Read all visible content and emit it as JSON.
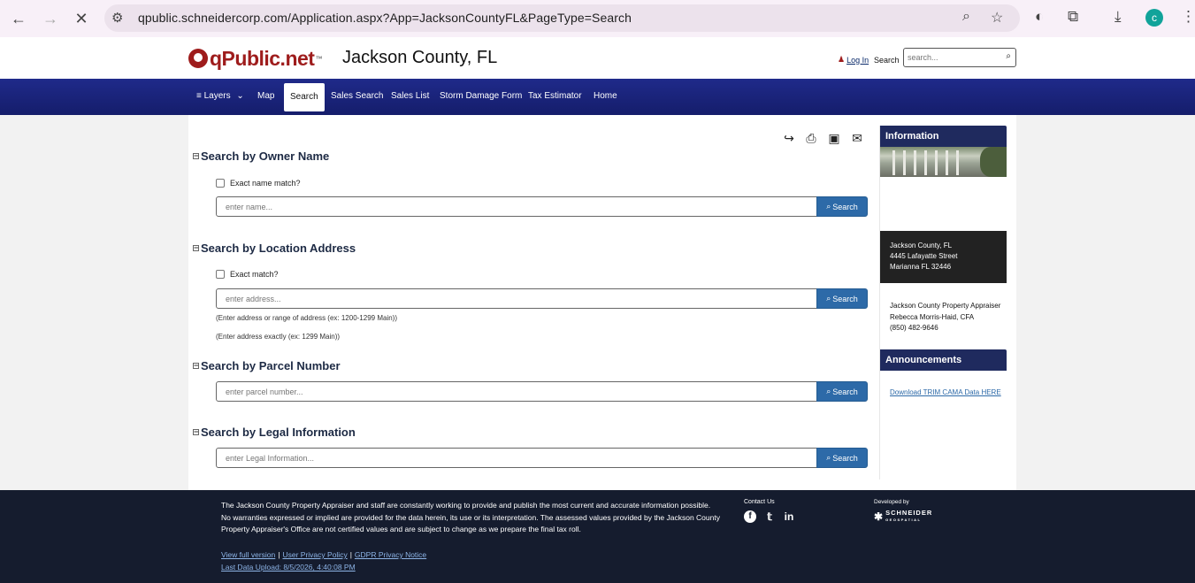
{
  "browser": {
    "url": "qpublic.schneidercorp.com/Application.aspx?App=JacksonCountyFL&PageType=Search",
    "avatar_letter": "c"
  },
  "header": {
    "logo_text": "qPublic.net",
    "logo_tm": "™",
    "county_title": "Jackson County, FL",
    "login_label": "Log In",
    "search_label": "Search",
    "search_placeholder": "search..."
  },
  "navbar": {
    "items": [
      {
        "label": "Layers"
      },
      {
        "label": "Map"
      },
      {
        "label": "Search"
      },
      {
        "label": "Sales Search"
      },
      {
        "label": "Sales List"
      },
      {
        "label": "Storm Damage Form"
      },
      {
        "label": "Tax Estimator"
      },
      {
        "label": "Home"
      }
    ],
    "active": "Search"
  },
  "sections": {
    "owner": {
      "title": "Search by Owner Name",
      "checkbox_label": "Exact name match?",
      "placeholder": "enter name...",
      "button": "Search"
    },
    "location": {
      "title": "Search by Location Address",
      "checkbox_label": "Exact match?",
      "placeholder": "enter address...",
      "button": "Search",
      "hint1": "(Enter address or range of address (ex: 1200-1299 Main))",
      "hint2": "(Enter address exactly (ex: 1299 Main))"
    },
    "parcel": {
      "title": "Search by Parcel Number",
      "placeholder": "enter parcel number...",
      "button": "Search"
    },
    "legal": {
      "title": "Search by Legal Information",
      "placeholder": "enter Legal Information...",
      "button": "Search"
    }
  },
  "sidebar": {
    "information_title": "Information",
    "address_lines": [
      "Jackson County, FL",
      "4445 Lafayatte Street",
      "Marianna FL 32446"
    ],
    "appraiser_lines": [
      "Jackson County Property Appraiser",
      "Rebecca Morris-Haid, CFA",
      "(850) 482-9646"
    ],
    "announcements_title": "Announcements",
    "announcement_link": "Download TRIM CAMA Data HERE"
  },
  "footer": {
    "disclaimer": "The Jackson County Property Appraiser and staff are constantly working to provide and publish the most current and accurate information possible. No warranties expressed or implied are provided for the data herein, its use or its interpretation. The assessed values provided by the Jackson County Property Appraiser's Office are not certified values and are subject to change as we prepare the final tax roll.",
    "link_full_version": "View full version",
    "link_privacy": "User Privacy Policy",
    "link_gdpr": "GDPR Privacy Notice",
    "last_upload": "Last Data Upload: 8/5/2026, 4:40:08 PM",
    "contact_us": "Contact Us",
    "developed_by": "Developed by",
    "schneider": "SCHNEIDER",
    "geospatial": "GEOSPATIAL"
  }
}
